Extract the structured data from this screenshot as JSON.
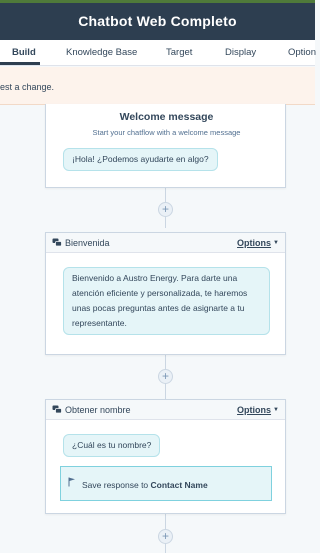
{
  "header": {
    "title": "Chatbot Web Completo"
  },
  "tabs": [
    {
      "label": "Build",
      "active": true
    },
    {
      "label": "Knowledge Base",
      "active": false
    },
    {
      "label": "Target",
      "active": false
    },
    {
      "label": "Display",
      "active": false
    },
    {
      "label": "Option",
      "active": false
    }
  ],
  "banner": {
    "text": "est a change."
  },
  "welcome": {
    "title": "Welcome message",
    "subtitle": "Start your chatflow with a welcome message",
    "message": "¡Hola! ¿Podemos ayudarte en algo?"
  },
  "cards": [
    {
      "name": "Bienvenida",
      "options_label": "Options",
      "message": "Bienvenido a Austro Energy. Para darte una atención eficiente y personalizada, te haremos unas pocas preguntas antes de asignarte a tu representante."
    },
    {
      "name": "Obtener nombre",
      "options_label": "Options",
      "message": "¿Cuál es tu nombre?",
      "save_prefix": "Save response to",
      "save_property": "Contact Name"
    }
  ],
  "add_symbol": "+",
  "colors": {
    "header_bg": "#2d3e50",
    "bubble_bg": "#e5f5f8",
    "banner_bg": "#fdf3ec"
  },
  "icons": [
    "chat-bubbles-icon",
    "flag-icon",
    "caret-down-icon",
    "plus-icon"
  ]
}
